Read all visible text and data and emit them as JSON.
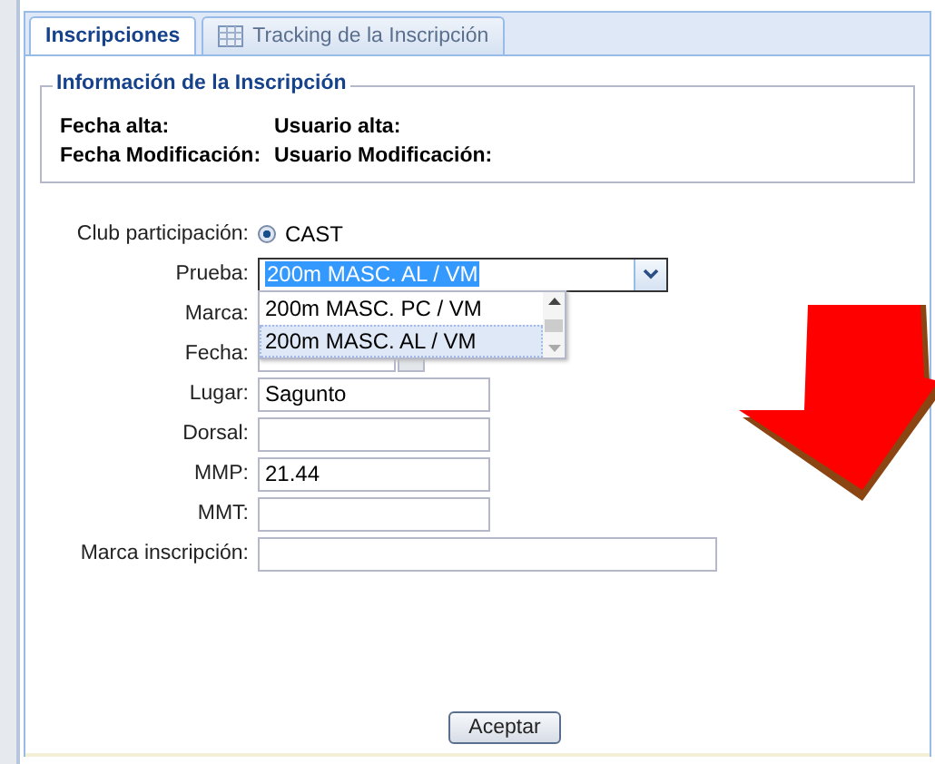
{
  "tabs": [
    {
      "label": "Inscripciones",
      "selected": true,
      "kind": "plain"
    },
    {
      "label": "Tracking de la Inscripción",
      "selected": false,
      "kind": "grid"
    }
  ],
  "info": {
    "legend": "Información de la Inscripción",
    "items": [
      {
        "label": "Fecha alta:"
      },
      {
        "label": "Usuario alta:"
      },
      {
        "label": "Fecha Modificación:"
      },
      {
        "label": "Usuario Modificación:"
      }
    ]
  },
  "fields": [
    {
      "label": "Club participación:",
      "kind": "radio",
      "option": "CAST",
      "checked": true
    },
    {
      "label": "Prueba:",
      "kind": "combo",
      "value": "200m MASC. AL / VM",
      "expanded": true,
      "options": [
        {
          "label": "200m MASC. PC / VM",
          "selected": false
        },
        {
          "label": "200m MASC. AL / VM",
          "selected": true
        }
      ]
    },
    {
      "label": "Marca:",
      "kind": "text"
    },
    {
      "label": "Fecha:",
      "kind": "date"
    },
    {
      "label": "Lugar:",
      "kind": "text",
      "value": "Sagunto"
    },
    {
      "label": "Dorsal:",
      "kind": "text"
    },
    {
      "label": "MMP:",
      "kind": "text",
      "value": "21.44"
    },
    {
      "label": "MMT:",
      "kind": "text"
    },
    {
      "label": "Marca inscripción:",
      "kind": "wide"
    }
  ],
  "buttons": [
    "Aceptar"
  ]
}
